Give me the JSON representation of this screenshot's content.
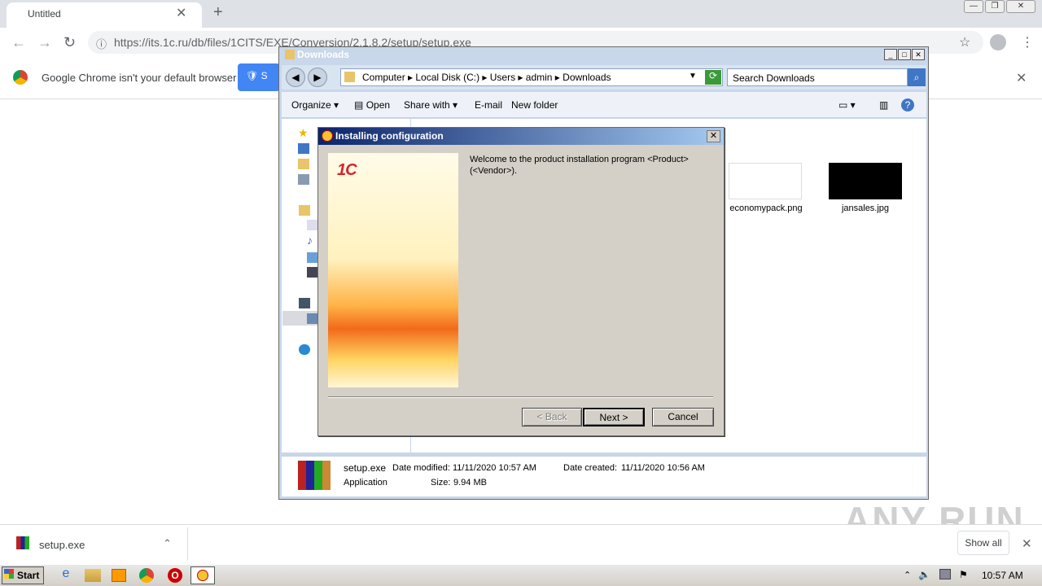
{
  "browser": {
    "tab_title": "Untitled",
    "url": "https://its.1c.ru/db/files/1CITS/EXE/Conversion/2.1.8.2/setup/setup.exe",
    "infobar_text": "Google Chrome isn't your default browser",
    "set_default_label": "S"
  },
  "explorer": {
    "title": "Downloads",
    "breadcrumb": "Computer  ▸  Local Disk (C:)  ▸  Users  ▸  admin  ▸  Downloads",
    "search_placeholder": "Search Downloads",
    "commands": {
      "organize": "Organize",
      "open": "Open",
      "share_with": "Share with",
      "email": "E-mail",
      "new_folder": "New folder"
    },
    "files": [
      {
        "name": "economypack.png"
      },
      {
        "name": "jansales.jpg"
      }
    ],
    "status": {
      "filename": "setup.exe",
      "date_modified_label": "Date modified:",
      "date_modified": "11/11/2020 10:57 AM",
      "date_created_label": "Date created:",
      "date_created": "11/11/2020 10:56 AM",
      "type": "Application",
      "size_label": "Size:",
      "size": "9.94 MB"
    }
  },
  "dialog": {
    "title": "Installing configuration",
    "welcome": "Welcome to the product installation program <Product> (<Vendor>).",
    "back": "< Back",
    "next": "Next >",
    "cancel": "Cancel",
    "logo": "1C"
  },
  "download_bar": {
    "filename": "setup.exe",
    "show_all": "Show all"
  },
  "taskbar": {
    "start": "Start",
    "clock": "10:57 AM"
  },
  "watermark": "ANY RUN"
}
